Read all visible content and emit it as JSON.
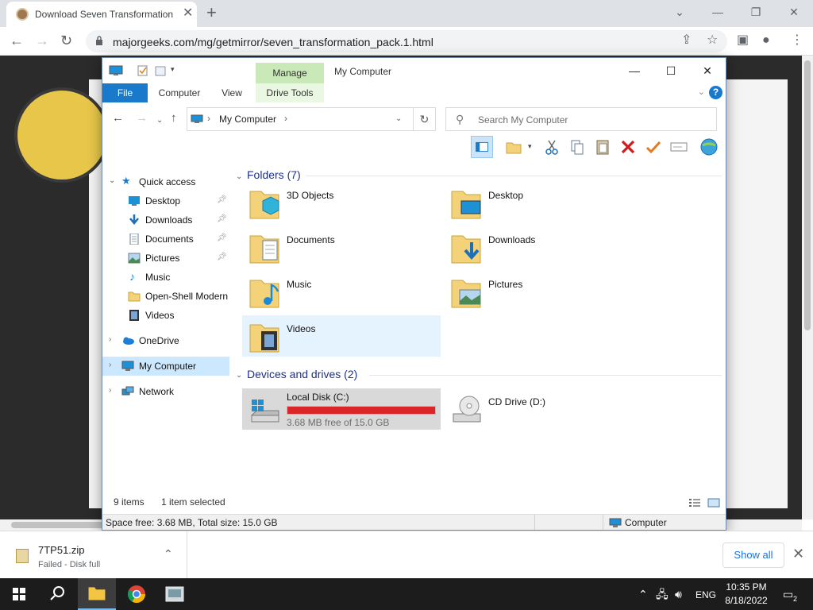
{
  "browser": {
    "tab_title": "Download Seven Transformation",
    "url": "majorgeeks.com/mg/getmirror/seven_transformation_pack.1.html"
  },
  "explorer": {
    "title": "My Computer",
    "ribbon": {
      "context_header": "Manage",
      "tabs": [
        "File",
        "Computer",
        "View",
        "Drive Tools"
      ]
    },
    "address": {
      "location": "My Computer"
    },
    "search": {
      "placeholder": "Search My Computer"
    },
    "nav": {
      "quick_access": "Quick access",
      "quick_items": [
        {
          "label": "Desktop",
          "pinned": true,
          "icon": "desktop-icon"
        },
        {
          "label": "Downloads",
          "pinned": true,
          "icon": "downloads-icon"
        },
        {
          "label": "Documents",
          "pinned": true,
          "icon": "documents-icon"
        },
        {
          "label": "Pictures",
          "pinned": true,
          "icon": "pictures-icon"
        },
        {
          "label": "Music",
          "pinned": false,
          "icon": "music-icon"
        },
        {
          "label": "Open-Shell Modern",
          "pinned": false,
          "icon": "folder-icon"
        },
        {
          "label": "Videos",
          "pinned": false,
          "icon": "videos-icon"
        }
      ],
      "onedrive": "OneDrive",
      "my_computer": "My Computer",
      "network": "Network"
    },
    "folders": {
      "header": "Folders (7)",
      "items": [
        "3D Objects",
        "Desktop",
        "Documents",
        "Downloads",
        "Music",
        "Pictures",
        "Videos"
      ],
      "selected": "Videos"
    },
    "drives": {
      "header": "Devices and drives (2)",
      "items": [
        {
          "name": "Local Disk (C:)",
          "free_text": "3.68 MB free of 15.0 GB",
          "used_fraction": 0.9998,
          "selected": true
        },
        {
          "name": "CD Drive (D:)"
        }
      ]
    },
    "status": {
      "items": "9 items",
      "selected": "1 item selected"
    },
    "details": {
      "space": "Space free: 3.68 MB, Total size: 15.0 GB",
      "location": "Computer"
    },
    "colors": {
      "accent": "#1979ca",
      "drive_full": "#da2626",
      "manage": "#c9e9b8"
    }
  },
  "download": {
    "filename": "7TP51.zip",
    "status": "Failed - Disk full",
    "show_all": "Show all"
  },
  "taskbar": {
    "language": "ENG",
    "time": "10:35 PM",
    "date": "8/18/2022",
    "notifications": "2"
  }
}
